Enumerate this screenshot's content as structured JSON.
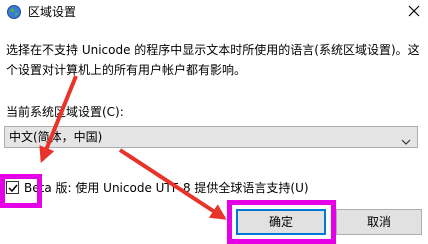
{
  "window": {
    "title": "区域设置",
    "icon": "globe-icon",
    "close_icon": "close-icon"
  },
  "content": {
    "description": "选择在不支持 Unicode 的程序中显示文本时所使用的语言(系统区域设置)。这\n个设置对计算机上的所有用户帐户都有影响。",
    "current_label": "当前系统区域设置(C):",
    "dropdown": {
      "value": "中文(简体，中国)",
      "icon": "chevron-down-icon"
    },
    "beta": {
      "checked": true,
      "label": "Beta 版: 使用 Unicode UTF-8 提供全球语言支持(U)"
    }
  },
  "buttons": {
    "ok": "确定",
    "cancel": "取消"
  },
  "annotation": {
    "highlight_color": "#e600e6",
    "arrow_color": "#e8332a"
  }
}
